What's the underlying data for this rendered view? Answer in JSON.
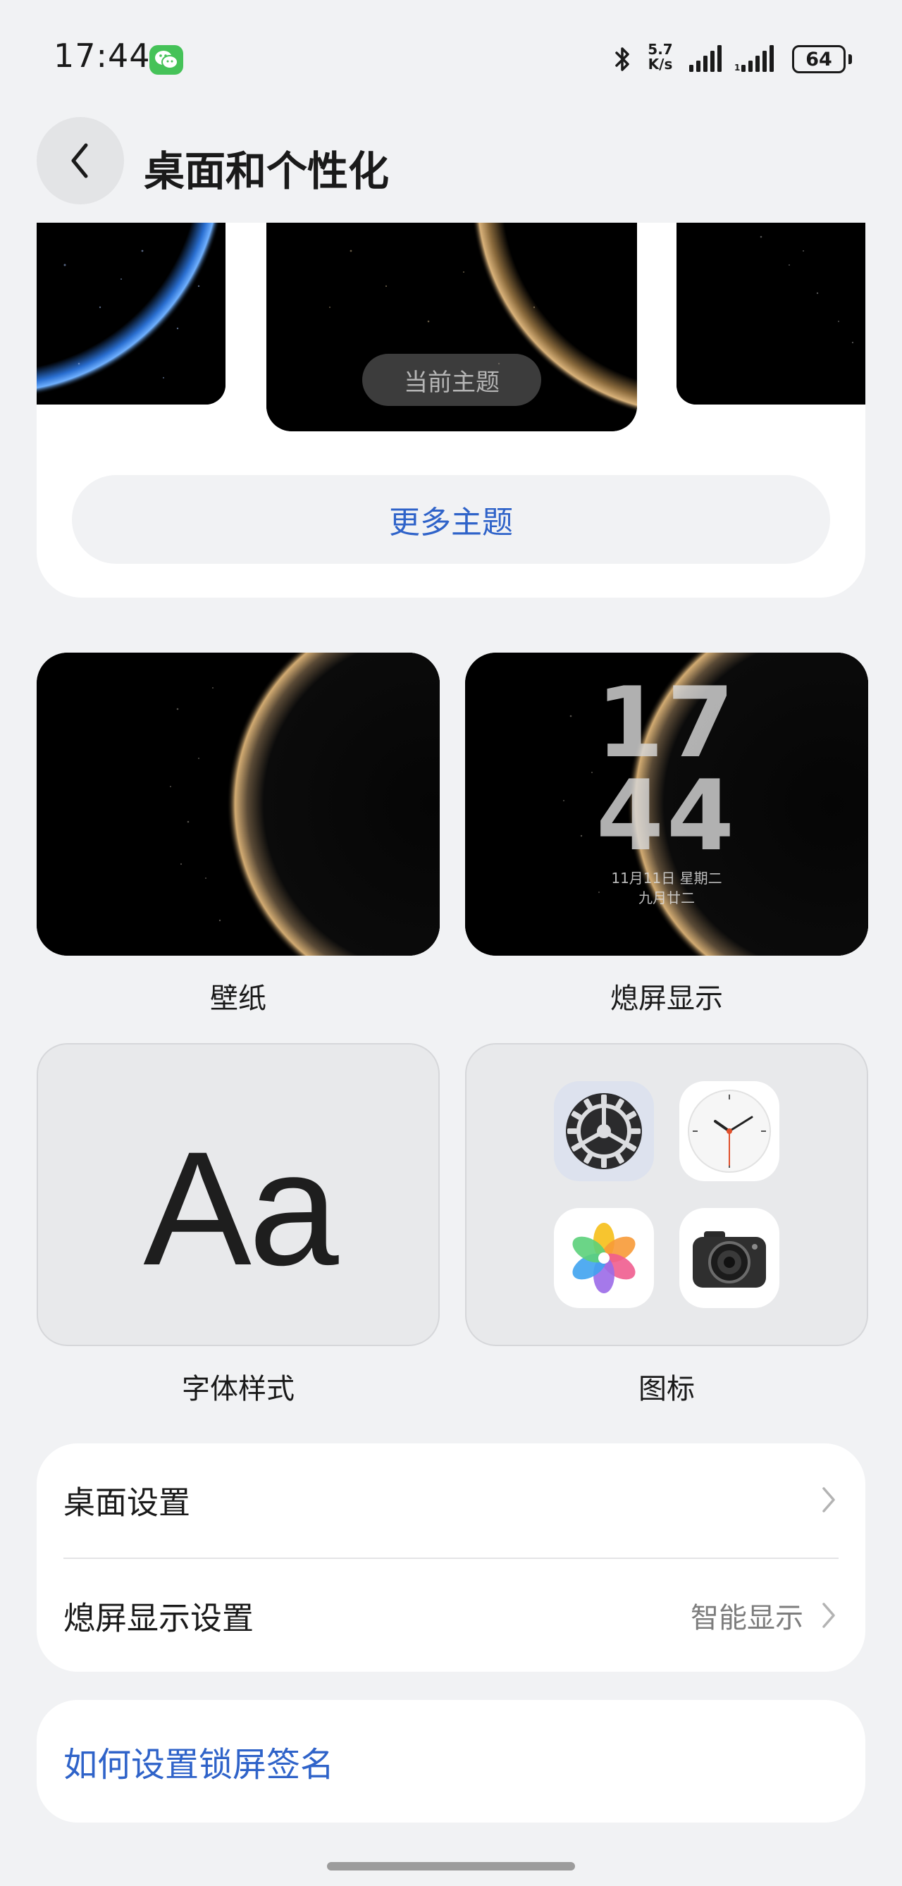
{
  "status_bar": {
    "time": "17:44",
    "net_speed_value": "5.7",
    "net_speed_unit": "K/s",
    "battery_level": "64"
  },
  "header": {
    "title": "桌面和个性化"
  },
  "theme_section": {
    "current_theme_badge": "当前主题",
    "more_themes_button": "更多主题"
  },
  "tiles": {
    "wallpaper": {
      "label": "壁纸"
    },
    "aod": {
      "label": "熄屏显示",
      "clock_hour": "17",
      "clock_minute": "44",
      "date_line": "11月11日  星期二",
      "lunar_line": "九月廿二"
    },
    "font": {
      "label": "字体样式",
      "sample": "Aa"
    },
    "icons": {
      "label": "图标",
      "apps": [
        "settings-app-icon",
        "clock-app-icon",
        "photos-app-icon",
        "camera-app-icon"
      ]
    }
  },
  "settings_list": {
    "desktop_settings": "桌面设置",
    "aod_settings": "熄屏显示设置",
    "aod_settings_value": "智能显示"
  },
  "help": {
    "link": "如何设置锁屏签名"
  },
  "colors": {
    "accent": "#2f63c9",
    "background": "#f1f2f4",
    "card": "#ffffff"
  }
}
